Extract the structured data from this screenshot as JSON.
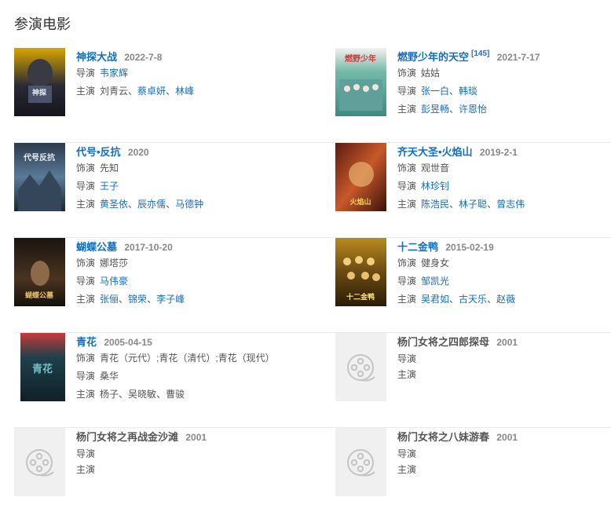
{
  "section_title": "参演电影",
  "labels": {
    "role": "饰演",
    "director": "导演",
    "cast": "主演"
  },
  "movies": [
    {
      "title": "神探大战",
      "date": "2022-7-8",
      "director": [
        "韦家辉"
      ],
      "cast": [
        "刘青云",
        "蔡卓妍",
        "林峰"
      ]
    },
    {
      "title": "燃野少年的天空",
      "sup": "[145]",
      "date": "2021-7-17",
      "role": "姑姑",
      "director": [
        "张一白",
        "韩琰"
      ],
      "cast": [
        "彭昱畅",
        "许恩怡"
      ]
    },
    {
      "title": "代号•反抗",
      "date": "2020",
      "role": "先知",
      "director": [
        "王子"
      ],
      "cast": [
        "黄圣依",
        "辰亦儒",
        "马德钟"
      ]
    },
    {
      "title": "齐天大圣•火焰山",
      "date": "2019-2-1",
      "role": "观世音",
      "director": [
        "林珍钊"
      ],
      "cast": [
        "陈浩民",
        "林子聪",
        "曾志伟"
      ]
    },
    {
      "title": "蝴蝶公墓",
      "date": "2017-10-20",
      "role": "娜塔莎",
      "director": [
        "马伟豪"
      ],
      "cast": [
        "张俪",
        "锦荣",
        "李子峰"
      ]
    },
    {
      "title": "十二金鸭",
      "date": "2015-02-19",
      "role": "健身女",
      "director": [
        "邹凯光"
      ],
      "cast": [
        "吴君如",
        "古天乐",
        "赵薇"
      ]
    },
    {
      "title": "青花",
      "date": "2005-04-15",
      "role": "青花（元代）;青花（清代）;青花（现代）",
      "director": [
        "桑华"
      ],
      "cast": [
        "杨子",
        "吴晓敏",
        "曹骏"
      ]
    },
    {
      "title": "杨门女将之四郎探母",
      "date": "2001"
    },
    {
      "title": "杨门女将之再战金沙滩",
      "date": "2001"
    },
    {
      "title": "杨门女将之八妹游春",
      "date": "2001"
    }
  ],
  "poster_icons": [
    "film-reel-icon"
  ]
}
